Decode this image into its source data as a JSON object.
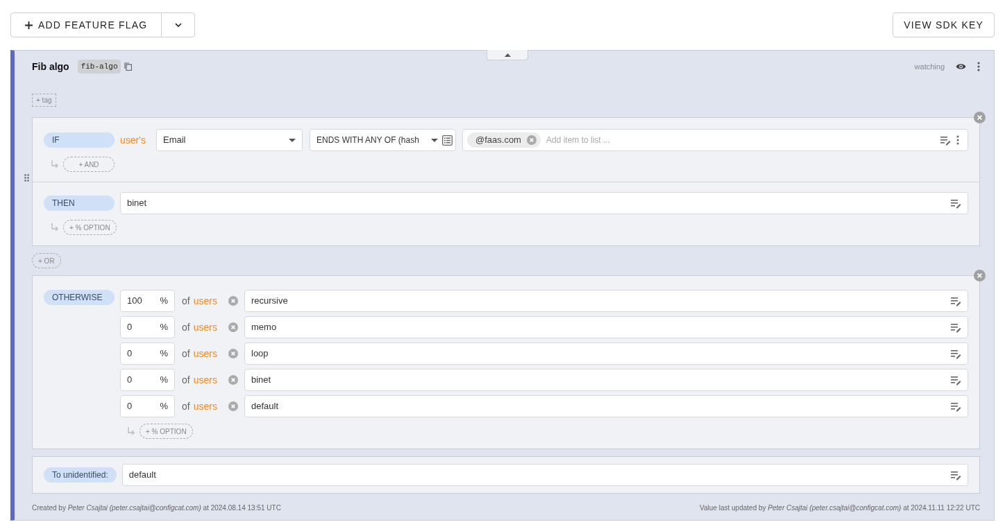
{
  "toolbar": {
    "add_button": "ADD FEATURE FLAG",
    "sdk_key_button": "VIEW SDK KEY"
  },
  "flag": {
    "name": "Fib algo",
    "key": "fib-algo",
    "add_tag": "+ tag",
    "watch_label": "watching"
  },
  "rule": {
    "if_label": "IF",
    "subject": "user's",
    "attribute": "Email",
    "comparator": "ENDS WITH ANY OF (hash",
    "items": [
      "@faas.com"
    ],
    "item_placeholder": "Add item to list ...",
    "add_and": "+ AND",
    "then_label": "THEN",
    "then_value": "binet",
    "add_option": "+ % OPTION"
  },
  "add_or": "+ OR",
  "otherwise": {
    "label": "OTHERWISE",
    "options": [
      {
        "percent": "100",
        "unit": "%",
        "of": "of",
        "users": "users",
        "value": "recursive"
      },
      {
        "percent": "0",
        "unit": "%",
        "of": "of",
        "users": "users",
        "value": "memo"
      },
      {
        "percent": "0",
        "unit": "%",
        "of": "of",
        "users": "users",
        "value": "loop"
      },
      {
        "percent": "0",
        "unit": "%",
        "of": "of",
        "users": "users",
        "value": "binet"
      },
      {
        "percent": "0",
        "unit": "%",
        "of": "of",
        "users": "users",
        "value": "default"
      }
    ],
    "add_option": "+ % OPTION"
  },
  "unidentified": {
    "label": "To unidentified:",
    "value": "default"
  },
  "footer": {
    "created": "Created by *Peter Csajtai (peter.csajtai@configcat.com)* at 2024.08.14 13:51 UTC",
    "updated": "Value last updated by *Peter Csajtai (peter.csajtai@configcat.com)* at 2024.11.11 12:22 UTC"
  }
}
